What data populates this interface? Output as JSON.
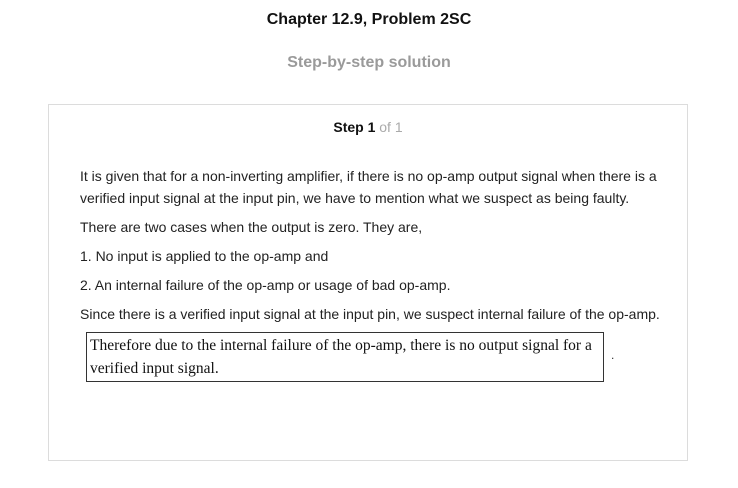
{
  "header": {
    "chapter_title": "Chapter 12.9, Problem 2SC",
    "subtitle": "Step-by-step solution"
  },
  "step": {
    "label": "Step 1",
    "of": "of 1"
  },
  "body": {
    "paragraphs": [
      "It is given that for a non-inverting amplifier, if there is no op-amp output signal when there is a verified input signal at the input pin, we have to mention what we suspect as being faulty.",
      "There are two cases when the output is zero. They are,",
      "1. No input is applied to the op-amp and",
      "2. An internal failure of the op-amp or usage of bad op-amp.",
      "Since there is a verified input signal at the input pin, we suspect internal failure of the op-amp."
    ],
    "answer": "Therefore due to the internal failure of the op-amp, there is no output signal for a verified input signal.",
    "answer_trailing": "."
  }
}
